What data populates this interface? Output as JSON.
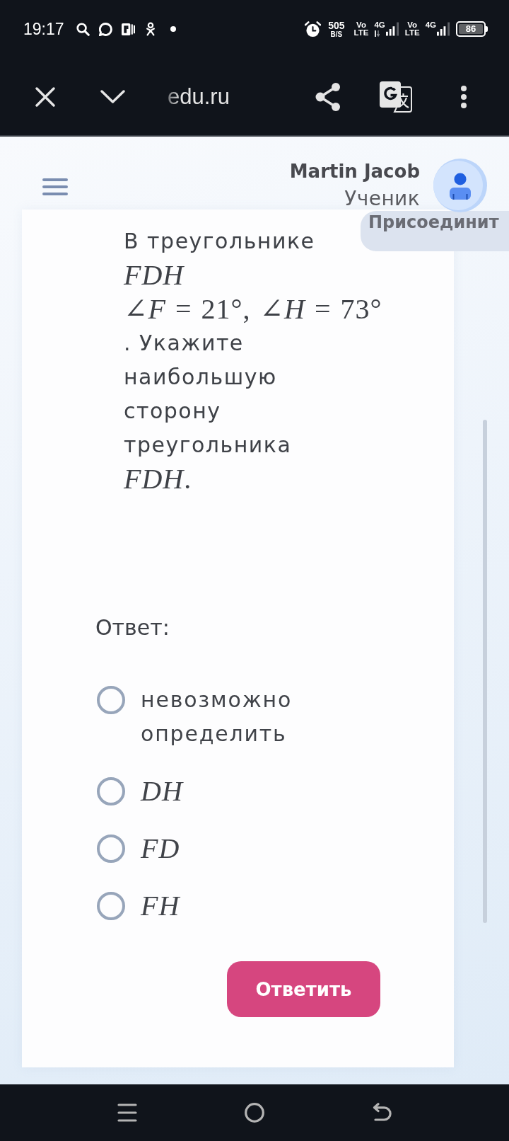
{
  "status_bar": {
    "time": "19:17",
    "speed_value": "505",
    "speed_unit": "B/S",
    "sims": [
      {
        "vo": "Vo",
        "lte": "LTE",
        "network": "4G",
        "data_active": true
      },
      {
        "vo": "Vo",
        "lte": "LTE",
        "network": "4G",
        "data_active": false
      }
    ],
    "battery": "86"
  },
  "browser_bar": {
    "url": "edu.ru"
  },
  "header": {
    "user_name": "Martin Jacob",
    "user_role": "Ученик",
    "action_button": "Присоединит"
  },
  "question": [
    {
      "kind": "text",
      "text": "В треугольнике"
    },
    {
      "kind": "math",
      "text": "*FDH*"
    },
    {
      "kind": "math",
      "text": "∠*F* = 21°, ∠*H* = 73°"
    },
    {
      "kind": "text",
      "text": ". Укажите наибольшую сторону треугольника"
    },
    {
      "kind": "math",
      "text": "*FDH*."
    }
  ],
  "answer_label": "Ответ:",
  "options": [
    {
      "kind": "text",
      "label": "невозможно определить",
      "selected": false
    },
    {
      "kind": "math",
      "label": "*DH*",
      "selected": false
    },
    {
      "kind": "math",
      "label": "*FD*",
      "selected": false
    },
    {
      "kind": "math",
      "label": "*FH*",
      "selected": false
    }
  ],
  "submit_button": "Ответить"
}
